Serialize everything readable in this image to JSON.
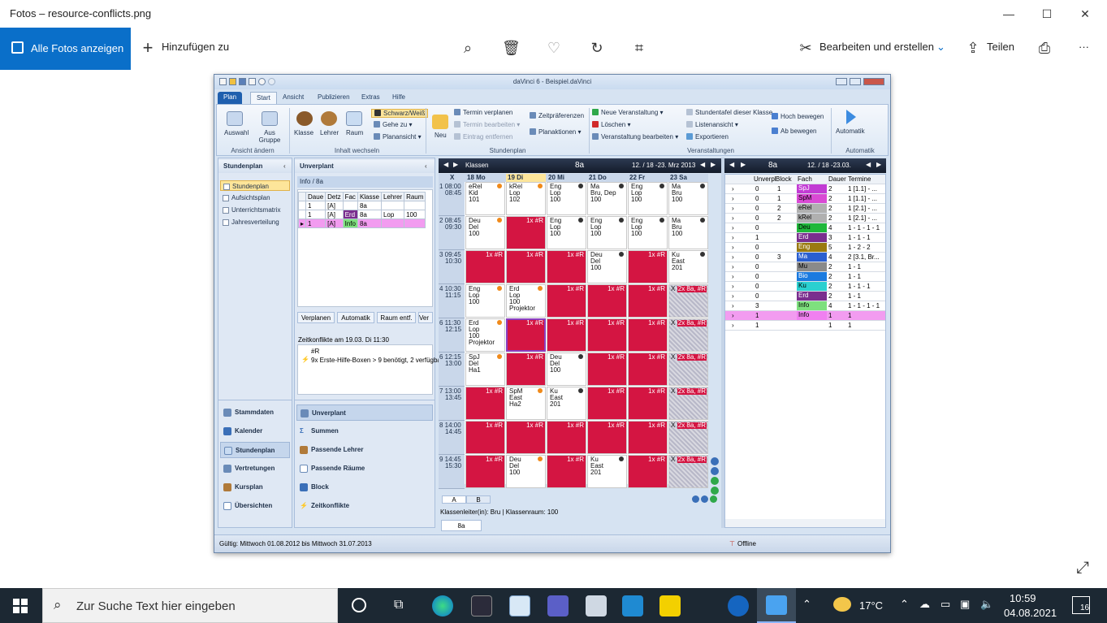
{
  "photos": {
    "window_title": "Fotos – resource-conflicts.png",
    "all_photos": "Alle Fotos anzeigen",
    "add_to": "Hinzufügen zu",
    "edit_create": "Bearbeiten und erstellen",
    "share": "Teilen",
    "more": "···"
  },
  "app": {
    "title": "daVinci 6 - Beispiel.daVinci",
    "tabs": [
      "Plan",
      "Start",
      "Ansicht",
      "Publizieren",
      "Extras",
      "Hilfe"
    ],
    "ribbon": {
      "auswahl": "Auswahl",
      "aus_gruppe": "Aus Gruppe",
      "grp_ansicht": "Ansicht ändern",
      "klasse": "Klasse",
      "lehrer": "Lehrer",
      "raum": "Raum",
      "schwarz_weiss": "Schwarz/Weiß",
      "gehe_zu": "Gehe zu",
      "planansicht": "Planansicht",
      "grp_inhalt": "Inhalt wechseln",
      "neu": "Neu",
      "termin_verplanen": "Termin verplanen",
      "termin_bearbeiten": "Termin bearbeiten",
      "eintrag_entfernen": "Eintrag entfernen",
      "zeitpraeferenzen": "Zeitpräferenzen",
      "planaktionen": "Planaktionen",
      "grp_stundenplan": "Stundenplan",
      "neue_veranstaltung": "Neue Veranstaltung",
      "loeschen": "Löschen",
      "veranstaltung_bearbeiten": "Veranstaltung bearbeiten",
      "stundentafel": "Stundentafel dieser Klasse",
      "listenansicht": "Listenansicht",
      "exportieren": "Exportieren",
      "hoch_bewegen": "Hoch bewegen",
      "ab_bewegen": "Ab bewegen",
      "grp_veranstaltungen": "Veranstaltungen",
      "automatik": "Automatik",
      "grp_automatik": "Automatik"
    },
    "nav": {
      "header": "Stundenplan",
      "items": [
        "Stundenplan",
        "Aufsichtsplan",
        "Unterrichtsmatrix",
        "Jahresverteilung"
      ],
      "big": [
        "Stammdaten",
        "Kalender",
        "Stundenplan",
        "Vertretungen",
        "Kursplan",
        "Übersichten"
      ]
    },
    "unverplant": {
      "header": "Unverplant",
      "sub": "Info / 8a",
      "cols": [
        "Daue",
        "Detz",
        "Fac",
        "Klasse",
        "Lehrer",
        "Raum"
      ],
      "rows": [
        [
          "1",
          "[A]",
          "",
          "8a",
          "",
          ""
        ],
        [
          "1",
          "[A]",
          "Erd",
          "8a",
          "Lop",
          "100"
        ],
        [
          "1",
          "[A]",
          "Info",
          "8a",
          "",
          ""
        ]
      ],
      "buttons": [
        "Verplanen",
        "Automatik",
        "Raum entf.",
        "Ver"
      ],
      "conflict_title": "Zeitkonflikte am 19.03. Di 11:30",
      "conflict_code": "#R",
      "conflict_text": "9x Erste-Hilfe-Boxen > 9 benötigt, 2 verfügbar",
      "big": [
        "Unverplant",
        "Summen",
        "Passende Lehrer",
        "Passende Räume",
        "Block",
        "Zeitkonflikte"
      ]
    },
    "timetable": {
      "label": "Klassen",
      "class": "8a",
      "range": "12. / 18 -23. Mrz 2013",
      "days": [
        [
          "18",
          "Mo"
        ],
        [
          "19",
          "Di"
        ],
        [
          "20",
          "Mi"
        ],
        [
          "21",
          "Do"
        ],
        [
          "22",
          "Fr"
        ],
        [
          "23",
          "Sa"
        ]
      ],
      "periods": [
        [
          "1",
          "08:00",
          "08:45"
        ],
        [
          "2",
          "08:45",
          "09:30"
        ],
        [
          "3",
          "09:45",
          "10:30"
        ],
        [
          "4",
          "10:30",
          "11:15"
        ],
        [
          "6",
          "11:30",
          "12:15"
        ],
        [
          "6",
          "12:15",
          "13:00"
        ],
        [
          "7",
          "13:00",
          "13:45"
        ],
        [
          "8",
          "14:00",
          "14:45"
        ],
        [
          "9",
          "14:45",
          "15:30"
        ]
      ],
      "conflict": "1x #R",
      "conflict_sa": "2x 8a, #R",
      "tabs": [
        "A",
        "B"
      ],
      "footer": "Klassenleiter(in): Bru | Klassenraum: 100",
      "footer_tab": "8a"
    },
    "right": {
      "class": "8a",
      "range": "12. / 18 -23.03.",
      "cols": [
        "Unverpl",
        "Block",
        "Fach",
        "Dauer",
        "Termine"
      ],
      "rows": [
        [
          "0",
          "1",
          "SpJ",
          "2",
          "1 [1.1] - ...",
          "#c23bd4"
        ],
        [
          "0",
          "1",
          "SpM",
          "2",
          "1 [1.1] - ...",
          "#d94ad4"
        ],
        [
          "0",
          "2",
          "eRel",
          "2",
          "1 [2.1] - ...",
          "#b0b0b0"
        ],
        [
          "0",
          "2",
          "kRel",
          "2",
          "1 [2.1] - ...",
          "#b0b0b0"
        ],
        [
          "0",
          "",
          "Deu",
          "4",
          "1 - 1 - 1 - 1",
          "#1fb83a"
        ],
        [
          "1",
          "",
          "Erd",
          "3",
          "1 - 1 - 1",
          "#7a2e8e"
        ],
        [
          "0",
          "",
          "Eng",
          "5",
          "1 - 2 - 2",
          "#9a7a10"
        ],
        [
          "0",
          "3",
          "Ma",
          "4",
          "2 [3.1, Br...",
          "#2a5fd0"
        ],
        [
          "0",
          "",
          "Mu",
          "2",
          "1 - 1",
          "#8a8a8a"
        ],
        [
          "0",
          "",
          "Bio",
          "2",
          "1 - 1",
          "#1a7adf"
        ],
        [
          "0",
          "",
          "Ku",
          "2",
          "1 - 1 - 1",
          "#2ad0d0"
        ],
        [
          "0",
          "",
          "Erd",
          "2",
          "1 - 1",
          "#7a2e8e"
        ],
        [
          "3",
          "",
          "Info",
          "4",
          "1 - 1 - 1 - 1",
          "#7ee07e"
        ],
        [
          "1",
          "",
          "Info",
          "1",
          "1",
          "#f080f0"
        ],
        [
          "1",
          "",
          "",
          "1",
          "1",
          "#ffffff"
        ]
      ]
    },
    "status": {
      "left": "Gültig: Mittwoch 01.08.2012 bis Mittwoch 31.07.2013",
      "right": "Offline"
    }
  },
  "taskbar": {
    "search": "Zur Suche Text hier eingeben",
    "temp": "17°C",
    "time": "10:59",
    "date": "04.08.2021",
    "badge": "16"
  }
}
